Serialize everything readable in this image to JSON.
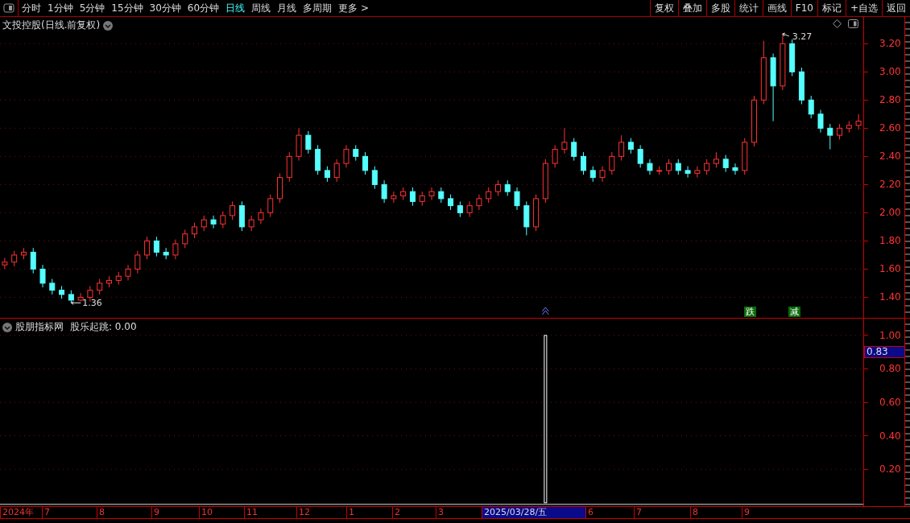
{
  "toolbar": {
    "periods": [
      {
        "label": "分时",
        "selected": false
      },
      {
        "label": "1分钟",
        "selected": false
      },
      {
        "label": "5分钟",
        "selected": false
      },
      {
        "label": "15分钟",
        "selected": false
      },
      {
        "label": "30分钟",
        "selected": false
      },
      {
        "label": "60分钟",
        "selected": false
      },
      {
        "label": "日线",
        "selected": true
      },
      {
        "label": "周线",
        "selected": false
      },
      {
        "label": "月线",
        "selected": false
      },
      {
        "label": "多周期",
        "selected": false
      },
      {
        "label": "更多 >",
        "selected": false
      }
    ],
    "buttons": [
      "复权",
      "叠加",
      "多股",
      "统计",
      "画线",
      "F10",
      "标记",
      "+自选",
      "返回"
    ]
  },
  "price_panel": {
    "title": "文投控股(日线.前复权)",
    "high_mark": "3.27",
    "low_mark": "1.36",
    "signals": [
      "跌",
      "减"
    ],
    "chart_data": {
      "type": "candlestick",
      "grid": true,
      "ylim": [
        1.26,
        3.39
      ],
      "yticks": [
        {
          "value": 1.4,
          "label": "1.40"
        },
        {
          "value": 1.6,
          "label": "1.60"
        },
        {
          "value": 1.8,
          "label": "1.80"
        },
        {
          "value": 2.0,
          "label": "2.00"
        },
        {
          "value": 2.2,
          "label": "2.20"
        },
        {
          "value": 2.4,
          "label": "2.40"
        },
        {
          "value": 2.6,
          "label": "2.60"
        },
        {
          "value": 2.8,
          "label": "2.80"
        },
        {
          "value": 3.0,
          "label": "3.00"
        },
        {
          "value": 3.2,
          "label": "3.20"
        }
      ],
      "ohlc": [
        [
          1.63,
          1.68,
          1.6,
          1.65
        ],
        [
          1.65,
          1.73,
          1.62,
          1.7
        ],
        [
          1.7,
          1.75,
          1.67,
          1.72
        ],
        [
          1.72,
          1.75,
          1.57,
          1.6
        ],
        [
          1.6,
          1.63,
          1.47,
          1.5
        ],
        [
          1.5,
          1.53,
          1.42,
          1.45
        ],
        [
          1.45,
          1.48,
          1.39,
          1.42
        ],
        [
          1.42,
          1.45,
          1.36,
          1.38
        ],
        [
          1.38,
          1.43,
          1.37,
          1.4
        ],
        [
          1.4,
          1.48,
          1.37,
          1.45
        ],
        [
          1.45,
          1.53,
          1.42,
          1.5
        ],
        [
          1.5,
          1.55,
          1.47,
          1.52
        ],
        [
          1.52,
          1.58,
          1.49,
          1.55
        ],
        [
          1.55,
          1.63,
          1.52,
          1.6
        ],
        [
          1.6,
          1.73,
          1.57,
          1.7
        ],
        [
          1.7,
          1.83,
          1.67,
          1.8
        ],
        [
          1.8,
          1.83,
          1.69,
          1.72
        ],
        [
          1.72,
          1.75,
          1.67,
          1.7
        ],
        [
          1.7,
          1.81,
          1.67,
          1.78
        ],
        [
          1.78,
          1.88,
          1.75,
          1.85
        ],
        [
          1.85,
          1.93,
          1.82,
          1.9
        ],
        [
          1.9,
          1.98,
          1.87,
          1.95
        ],
        [
          1.95,
          1.98,
          1.89,
          1.92
        ],
        [
          1.92,
          2.01,
          1.89,
          1.98
        ],
        [
          1.98,
          2.08,
          1.95,
          2.05
        ],
        [
          2.05,
          2.08,
          1.87,
          1.9
        ],
        [
          1.9,
          1.98,
          1.87,
          1.95
        ],
        [
          1.95,
          2.03,
          1.92,
          2.0
        ],
        [
          2.0,
          2.13,
          1.97,
          2.1
        ],
        [
          2.1,
          2.28,
          2.07,
          2.25
        ],
        [
          2.25,
          2.43,
          2.22,
          2.4
        ],
        [
          2.4,
          2.6,
          2.37,
          2.55
        ],
        [
          2.55,
          2.58,
          2.42,
          2.45
        ],
        [
          2.45,
          2.48,
          2.27,
          2.3
        ],
        [
          2.3,
          2.33,
          2.22,
          2.25
        ],
        [
          2.25,
          2.38,
          2.22,
          2.35
        ],
        [
          2.35,
          2.48,
          2.32,
          2.45
        ],
        [
          2.45,
          2.48,
          2.37,
          2.4
        ],
        [
          2.4,
          2.43,
          2.27,
          2.3
        ],
        [
          2.3,
          2.33,
          2.17,
          2.2
        ],
        [
          2.2,
          2.23,
          2.07,
          2.1
        ],
        [
          2.1,
          2.15,
          2.07,
          2.12
        ],
        [
          2.12,
          2.18,
          2.09,
          2.15
        ],
        [
          2.15,
          2.18,
          2.05,
          2.08
        ],
        [
          2.08,
          2.15,
          2.05,
          2.12
        ],
        [
          2.12,
          2.18,
          2.09,
          2.15
        ],
        [
          2.15,
          2.18,
          2.07,
          2.1
        ],
        [
          2.1,
          2.13,
          2.02,
          2.05
        ],
        [
          2.05,
          2.08,
          1.97,
          2.0
        ],
        [
          2.0,
          2.08,
          1.97,
          2.05
        ],
        [
          2.05,
          2.13,
          2.02,
          2.1
        ],
        [
          2.1,
          2.18,
          2.07,
          2.15
        ],
        [
          2.15,
          2.23,
          2.12,
          2.2
        ],
        [
          2.2,
          2.23,
          2.12,
          2.15
        ],
        [
          2.15,
          2.18,
          2.02,
          2.05
        ],
        [
          2.05,
          2.08,
          1.84,
          1.9
        ],
        [
          1.9,
          2.13,
          1.87,
          2.1
        ],
        [
          2.1,
          2.38,
          2.07,
          2.35
        ],
        [
          2.35,
          2.48,
          2.32,
          2.45
        ],
        [
          2.45,
          2.6,
          2.42,
          2.5
        ],
        [
          2.5,
          2.53,
          2.37,
          2.4
        ],
        [
          2.4,
          2.43,
          2.27,
          2.3
        ],
        [
          2.3,
          2.33,
          2.22,
          2.25
        ],
        [
          2.25,
          2.33,
          2.22,
          2.3
        ],
        [
          2.3,
          2.43,
          2.27,
          2.4
        ],
        [
          2.4,
          2.55,
          2.37,
          2.5
        ],
        [
          2.5,
          2.53,
          2.42,
          2.45
        ],
        [
          2.45,
          2.48,
          2.32,
          2.35
        ],
        [
          2.35,
          2.38,
          2.27,
          2.3
        ],
        [
          2.3,
          2.33,
          2.27,
          2.3
        ],
        [
          2.3,
          2.38,
          2.27,
          2.35
        ],
        [
          2.35,
          2.38,
          2.27,
          2.3
        ],
        [
          2.3,
          2.33,
          2.25,
          2.28
        ],
        [
          2.28,
          2.33,
          2.25,
          2.3
        ],
        [
          2.3,
          2.38,
          2.27,
          2.35
        ],
        [
          2.35,
          2.43,
          2.32,
          2.38
        ],
        [
          2.38,
          2.41,
          2.29,
          2.32
        ],
        [
          2.32,
          2.35,
          2.27,
          2.3
        ],
        [
          2.3,
          2.53,
          2.27,
          2.5
        ],
        [
          2.5,
          2.83,
          2.47,
          2.8
        ],
        [
          2.8,
          3.22,
          2.77,
          3.1
        ],
        [
          3.1,
          3.13,
          2.65,
          2.9
        ],
        [
          2.9,
          3.27,
          2.87,
          3.2
        ],
        [
          3.2,
          3.23,
          2.97,
          3.0
        ],
        [
          3.0,
          3.03,
          2.77,
          2.8
        ],
        [
          2.8,
          2.83,
          2.67,
          2.7
        ],
        [
          2.7,
          2.73,
          2.57,
          2.6
        ],
        [
          2.6,
          2.63,
          2.45,
          2.55
        ],
        [
          2.55,
          2.63,
          2.52,
          2.6
        ],
        [
          2.6,
          2.65,
          2.57,
          2.62
        ],
        [
          2.62,
          2.7,
          2.59,
          2.65
        ]
      ]
    }
  },
  "indicator_panel": {
    "source": "股朋指标网",
    "name": "股乐起跳: 0.00",
    "cursor_value": "0.83",
    "chart_data": {
      "type": "bar",
      "grid": true,
      "ylim": [
        -0.02,
        1.1
      ],
      "yticks": [
        {
          "value": 0.2,
          "label": "0.20"
        },
        {
          "value": 0.4,
          "label": "0.40"
        },
        {
          "value": 0.6,
          "label": "0.60"
        },
        {
          "value": 0.8,
          "label": "0.80"
        },
        {
          "value": 1.0,
          "label": "1.00"
        }
      ],
      "values": [
        0,
        0,
        0,
        0,
        0,
        0,
        0,
        0,
        0,
        0,
        0,
        0,
        0,
        0,
        0,
        0,
        0,
        0,
        0,
        0,
        0,
        0,
        0,
        0,
        0,
        0,
        0,
        0,
        0,
        0,
        0,
        0,
        0,
        0,
        0,
        0,
        0,
        0,
        0,
        0,
        0,
        0,
        0,
        0,
        0,
        0,
        0,
        0,
        0,
        0,
        0,
        0,
        0,
        0,
        0,
        0,
        0,
        1,
        0,
        0,
        0,
        0,
        0,
        0,
        0,
        0,
        0,
        0,
        0,
        0,
        0,
        0,
        0,
        0,
        0,
        0,
        0,
        0,
        0,
        0,
        0,
        0,
        0,
        0,
        0,
        0,
        0,
        0,
        0,
        0,
        0
      ]
    }
  },
  "date_axis": [
    {
      "label": "2024年",
      "selected": false
    },
    {
      "label": "7",
      "selected": false
    },
    {
      "label": "8",
      "selected": false
    },
    {
      "label": "9",
      "selected": false
    },
    {
      "label": "10",
      "selected": false
    },
    {
      "label": "11",
      "selected": false
    },
    {
      "label": "12",
      "selected": false
    },
    {
      "label": "1",
      "selected": false
    },
    {
      "label": "2",
      "selected": false
    },
    {
      "label": "3",
      "selected": false
    },
    {
      "label": "2025/03/28/五",
      "selected": true
    },
    {
      "label": "6",
      "selected": false
    },
    {
      "label": "7",
      "selected": false
    },
    {
      "label": "8",
      "selected": false
    },
    {
      "label": "9",
      "selected": false
    }
  ]
}
